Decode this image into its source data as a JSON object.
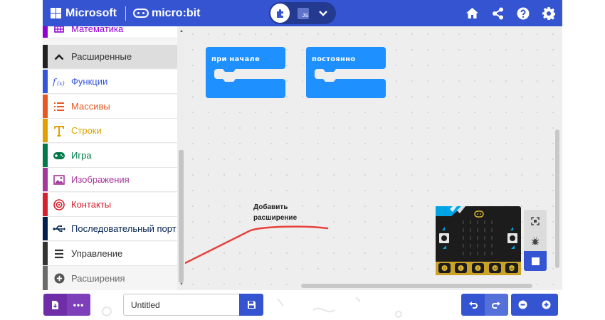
{
  "header": {
    "brand": "Microsoft",
    "product": "micro:bit",
    "mode_js": "JS",
    "colors": {
      "header_bg": "#3454d1",
      "toggle_bg": "#243a91"
    },
    "icons": [
      "home-icon",
      "share-icon",
      "help-icon",
      "settings-icon"
    ]
  },
  "toolbox": {
    "categories": [
      {
        "label": "Математика",
        "color": "#9400d3",
        "icon": "calculator-icon"
      },
      {
        "label": "Расширенные",
        "color": "#212121",
        "icon": "chevron-up-icon"
      },
      {
        "label": "Функции",
        "color": "#3455db",
        "icon": "function-icon"
      },
      {
        "label": "Массивы",
        "color": "#e65722",
        "icon": "list-icon"
      },
      {
        "label": "Строки",
        "color": "#e0a100",
        "icon": "text-icon"
      },
      {
        "label": "Игра",
        "color": "#007a4b",
        "icon": "gamepad-icon"
      },
      {
        "label": "Изображения",
        "color": "#a5369b",
        "icon": "image-icon"
      },
      {
        "label": "Контакты",
        "color": "#d5202e",
        "icon": "target-icon"
      },
      {
        "label": "Последовательный порт",
        "color": "#002050",
        "icon": "usb-icon"
      },
      {
        "label": "Управление",
        "color": "#333333",
        "icon": "bars-icon"
      },
      {
        "label": "Расширения",
        "color": "#6b6b6b",
        "icon": "plus-circle-icon"
      }
    ]
  },
  "workspace": {
    "blocks": [
      {
        "label": "при начале",
        "color": "#1e90ff"
      },
      {
        "label": "постоянно",
        "color": "#1e90ff"
      }
    ],
    "annotation": {
      "line1": "Добавить",
      "line2": "расширение",
      "arrow_color": "#e8413c"
    }
  },
  "simulator": {
    "board_color": "#1c1c1c",
    "accent_color": "#00a4e4",
    "pin_labels": [
      "0",
      "1",
      "2",
      "3V",
      "GND"
    ],
    "icons": [
      "fullscreen-icon",
      "debug-icon",
      "stop-icon"
    ]
  },
  "bottombar": {
    "project_name": "Untitled",
    "more_label": "•••",
    "icons": [
      "download-icon",
      "save-icon",
      "undo-icon",
      "redo-icon",
      "zoom-out-icon",
      "zoom-in-icon"
    ]
  }
}
